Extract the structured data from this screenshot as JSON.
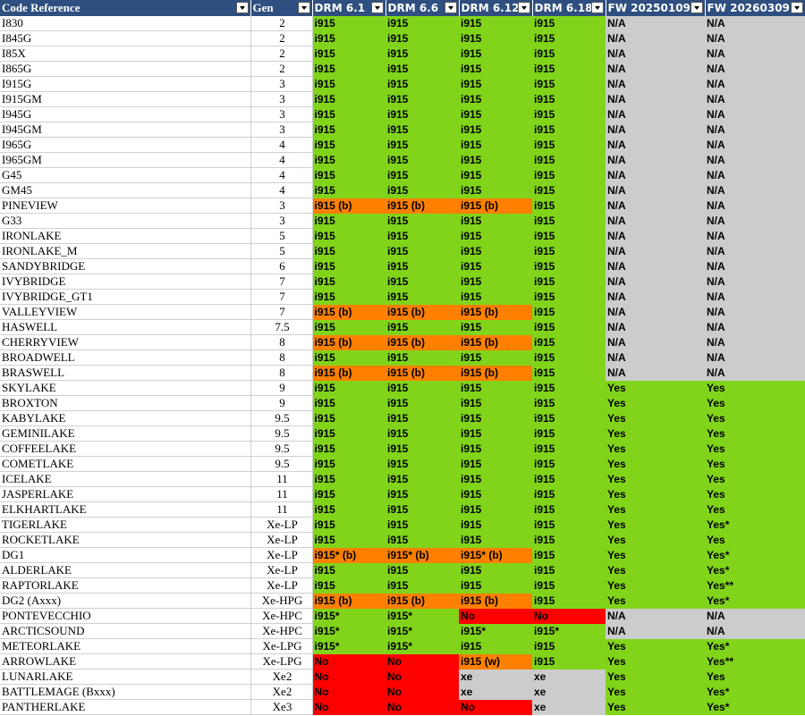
{
  "header": {
    "columns": [
      "Code Reference",
      "Gen",
      "DRM 6.1",
      "DRM 6.6",
      "DRM 6.12",
      "DRM 6.18",
      "FW 20250109",
      "FW 20260309"
    ]
  },
  "status_colors": {
    "supported": "#81d41a",
    "partial": "#ff8000",
    "unsupported": "#ff0000",
    "not_applicable": "#cccccc",
    "header_bg": "#2e4f7f"
  },
  "rows": [
    {
      "name": "I830",
      "gen": "2",
      "cells": [
        [
          "i915",
          "g"
        ],
        [
          "i915",
          "g"
        ],
        [
          "i915",
          "g"
        ],
        [
          "i915",
          "g"
        ],
        [
          "N/A",
          "x"
        ],
        [
          "N/A",
          "x"
        ]
      ]
    },
    {
      "name": "I845G",
      "gen": "2",
      "cells": [
        [
          "i915",
          "g"
        ],
        [
          "i915",
          "g"
        ],
        [
          "i915",
          "g"
        ],
        [
          "i915",
          "g"
        ],
        [
          "N/A",
          "x"
        ],
        [
          "N/A",
          "x"
        ]
      ]
    },
    {
      "name": "I85X",
      "gen": "2",
      "cells": [
        [
          "i915",
          "g"
        ],
        [
          "i915",
          "g"
        ],
        [
          "i915",
          "g"
        ],
        [
          "i915",
          "g"
        ],
        [
          "N/A",
          "x"
        ],
        [
          "N/A",
          "x"
        ]
      ]
    },
    {
      "name": "I865G",
      "gen": "2",
      "cells": [
        [
          "i915",
          "g"
        ],
        [
          "i915",
          "g"
        ],
        [
          "i915",
          "g"
        ],
        [
          "i915",
          "g"
        ],
        [
          "N/A",
          "x"
        ],
        [
          "N/A",
          "x"
        ]
      ]
    },
    {
      "name": "I915G",
      "gen": "3",
      "cells": [
        [
          "i915",
          "g"
        ],
        [
          "i915",
          "g"
        ],
        [
          "i915",
          "g"
        ],
        [
          "i915",
          "g"
        ],
        [
          "N/A",
          "x"
        ],
        [
          "N/A",
          "x"
        ]
      ]
    },
    {
      "name": "I915GM",
      "gen": "3",
      "cells": [
        [
          "i915",
          "g"
        ],
        [
          "i915",
          "g"
        ],
        [
          "i915",
          "g"
        ],
        [
          "i915",
          "g"
        ],
        [
          "N/A",
          "x"
        ],
        [
          "N/A",
          "x"
        ]
      ]
    },
    {
      "name": "I945G",
      "gen": "3",
      "cells": [
        [
          "i915",
          "g"
        ],
        [
          "i915",
          "g"
        ],
        [
          "i915",
          "g"
        ],
        [
          "i915",
          "g"
        ],
        [
          "N/A",
          "x"
        ],
        [
          "N/A",
          "x"
        ]
      ]
    },
    {
      "name": "I945GM",
      "gen": "3",
      "cells": [
        [
          "i915",
          "g"
        ],
        [
          "i915",
          "g"
        ],
        [
          "i915",
          "g"
        ],
        [
          "i915",
          "g"
        ],
        [
          "N/A",
          "x"
        ],
        [
          "N/A",
          "x"
        ]
      ]
    },
    {
      "name": "I965G",
      "gen": "4",
      "cells": [
        [
          "i915",
          "g"
        ],
        [
          "i915",
          "g"
        ],
        [
          "i915",
          "g"
        ],
        [
          "i915",
          "g"
        ],
        [
          "N/A",
          "x"
        ],
        [
          "N/A",
          "x"
        ]
      ]
    },
    {
      "name": "I965GM",
      "gen": "4",
      "cells": [
        [
          "i915",
          "g"
        ],
        [
          "i915",
          "g"
        ],
        [
          "i915",
          "g"
        ],
        [
          "i915",
          "g"
        ],
        [
          "N/A",
          "x"
        ],
        [
          "N/A",
          "x"
        ]
      ]
    },
    {
      "name": "G45",
      "gen": "4",
      "cells": [
        [
          "i915",
          "g"
        ],
        [
          "i915",
          "g"
        ],
        [
          "i915",
          "g"
        ],
        [
          "i915",
          "g"
        ],
        [
          "N/A",
          "x"
        ],
        [
          "N/A",
          "x"
        ]
      ]
    },
    {
      "name": "GM45",
      "gen": "4",
      "cells": [
        [
          "i915",
          "g"
        ],
        [
          "i915",
          "g"
        ],
        [
          "i915",
          "g"
        ],
        [
          "i915",
          "g"
        ],
        [
          "N/A",
          "x"
        ],
        [
          "N/A",
          "x"
        ]
      ]
    },
    {
      "name": "PINEVIEW",
      "gen": "3",
      "cells": [
        [
          "i915 (b)",
          "o"
        ],
        [
          "i915 (b)",
          "o"
        ],
        [
          "i915 (b)",
          "o"
        ],
        [
          "i915",
          "g"
        ],
        [
          "N/A",
          "x"
        ],
        [
          "N/A",
          "x"
        ]
      ]
    },
    {
      "name": "G33",
      "gen": "3",
      "cells": [
        [
          "i915",
          "g"
        ],
        [
          "i915",
          "g"
        ],
        [
          "i915",
          "g"
        ],
        [
          "i915",
          "g"
        ],
        [
          "N/A",
          "x"
        ],
        [
          "N/A",
          "x"
        ]
      ]
    },
    {
      "name": "IRONLAKE",
      "gen": "5",
      "cells": [
        [
          "i915",
          "g"
        ],
        [
          "i915",
          "g"
        ],
        [
          "i915",
          "g"
        ],
        [
          "i915",
          "g"
        ],
        [
          "N/A",
          "x"
        ],
        [
          "N/A",
          "x"
        ]
      ]
    },
    {
      "name": "IRONLAKE_M",
      "gen": "5",
      "cells": [
        [
          "i915",
          "g"
        ],
        [
          "i915",
          "g"
        ],
        [
          "i915",
          "g"
        ],
        [
          "i915",
          "g"
        ],
        [
          "N/A",
          "x"
        ],
        [
          "N/A",
          "x"
        ]
      ]
    },
    {
      "name": "SANDYBRIDGE",
      "gen": "6",
      "cells": [
        [
          "i915",
          "g"
        ],
        [
          "i915",
          "g"
        ],
        [
          "i915",
          "g"
        ],
        [
          "i915",
          "g"
        ],
        [
          "N/A",
          "x"
        ],
        [
          "N/A",
          "x"
        ]
      ]
    },
    {
      "name": "IVYBRIDGE",
      "gen": "7",
      "cells": [
        [
          "i915",
          "g"
        ],
        [
          "i915",
          "g"
        ],
        [
          "i915",
          "g"
        ],
        [
          "i915",
          "g"
        ],
        [
          "N/A",
          "x"
        ],
        [
          "N/A",
          "x"
        ]
      ]
    },
    {
      "name": "IVYBRIDGE_GT1",
      "gen": "7",
      "cells": [
        [
          "i915",
          "g"
        ],
        [
          "i915",
          "g"
        ],
        [
          "i915",
          "g"
        ],
        [
          "i915",
          "g"
        ],
        [
          "N/A",
          "x"
        ],
        [
          "N/A",
          "x"
        ]
      ]
    },
    {
      "name": "VALLEYVIEW",
      "gen": "7",
      "cells": [
        [
          "i915 (b)",
          "o"
        ],
        [
          "i915 (b)",
          "o"
        ],
        [
          "i915 (b)",
          "o"
        ],
        [
          "i915",
          "g"
        ],
        [
          "N/A",
          "x"
        ],
        [
          "N/A",
          "x"
        ]
      ]
    },
    {
      "name": "HASWELL",
      "gen": "7.5",
      "cells": [
        [
          "i915",
          "g"
        ],
        [
          "i915",
          "g"
        ],
        [
          "i915",
          "g"
        ],
        [
          "i915",
          "g"
        ],
        [
          "N/A",
          "x"
        ],
        [
          "N/A",
          "x"
        ]
      ]
    },
    {
      "name": "CHERRYVIEW",
      "gen": "8",
      "cells": [
        [
          "i915 (b)",
          "o"
        ],
        [
          "i915 (b)",
          "o"
        ],
        [
          "i915 (b)",
          "o"
        ],
        [
          "i915",
          "g"
        ],
        [
          "N/A",
          "x"
        ],
        [
          "N/A",
          "x"
        ]
      ]
    },
    {
      "name": "BROADWELL",
      "gen": "8",
      "cells": [
        [
          "i915",
          "g"
        ],
        [
          "i915",
          "g"
        ],
        [
          "i915",
          "g"
        ],
        [
          "i915",
          "g"
        ],
        [
          "N/A",
          "x"
        ],
        [
          "N/A",
          "x"
        ]
      ]
    },
    {
      "name": "BRASWELL",
      "gen": "8",
      "cells": [
        [
          "i915 (b)",
          "o"
        ],
        [
          "i915 (b)",
          "o"
        ],
        [
          "i915 (b)",
          "o"
        ],
        [
          "i915",
          "g"
        ],
        [
          "N/A",
          "x"
        ],
        [
          "N/A",
          "x"
        ]
      ]
    },
    {
      "name": "SKYLAKE",
      "gen": "9",
      "cells": [
        [
          "i915",
          "g"
        ],
        [
          "i915",
          "g"
        ],
        [
          "i915",
          "g"
        ],
        [
          "i915",
          "g"
        ],
        [
          "Yes",
          "g"
        ],
        [
          "Yes",
          "g"
        ]
      ]
    },
    {
      "name": "BROXTON",
      "gen": "9",
      "cells": [
        [
          "i915",
          "g"
        ],
        [
          "i915",
          "g"
        ],
        [
          "i915",
          "g"
        ],
        [
          "i915",
          "g"
        ],
        [
          "Yes",
          "g"
        ],
        [
          "Yes",
          "g"
        ]
      ]
    },
    {
      "name": "KABYLAKE",
      "gen": "9.5",
      "cells": [
        [
          "i915",
          "g"
        ],
        [
          "i915",
          "g"
        ],
        [
          "i915",
          "g"
        ],
        [
          "i915",
          "g"
        ],
        [
          "Yes",
          "g"
        ],
        [
          "Yes",
          "g"
        ]
      ]
    },
    {
      "name": "GEMINILAKE",
      "gen": "9.5",
      "cells": [
        [
          "i915",
          "g"
        ],
        [
          "i915",
          "g"
        ],
        [
          "i915",
          "g"
        ],
        [
          "i915",
          "g"
        ],
        [
          "Yes",
          "g"
        ],
        [
          "Yes",
          "g"
        ]
      ]
    },
    {
      "name": "COFFEELAKE",
      "gen": "9.5",
      "cells": [
        [
          "i915",
          "g"
        ],
        [
          "i915",
          "g"
        ],
        [
          "i915",
          "g"
        ],
        [
          "i915",
          "g"
        ],
        [
          "Yes",
          "g"
        ],
        [
          "Yes",
          "g"
        ]
      ]
    },
    {
      "name": "COMETLAKE",
      "gen": "9.5",
      "cells": [
        [
          "i915",
          "g"
        ],
        [
          "i915",
          "g"
        ],
        [
          "i915",
          "g"
        ],
        [
          "i915",
          "g"
        ],
        [
          "Yes",
          "g"
        ],
        [
          "Yes",
          "g"
        ]
      ]
    },
    {
      "name": "ICELAKE",
      "gen": "11",
      "cells": [
        [
          "i915",
          "g"
        ],
        [
          "i915",
          "g"
        ],
        [
          "i915",
          "g"
        ],
        [
          "i915",
          "g"
        ],
        [
          "Yes",
          "g"
        ],
        [
          "Yes",
          "g"
        ]
      ]
    },
    {
      "name": "JASPERLAKE",
      "gen": "11",
      "cells": [
        [
          "i915",
          "g"
        ],
        [
          "i915",
          "g"
        ],
        [
          "i915",
          "g"
        ],
        [
          "i915",
          "g"
        ],
        [
          "Yes",
          "g"
        ],
        [
          "Yes",
          "g"
        ]
      ]
    },
    {
      "name": "ELKHARTLAKE",
      "gen": "11",
      "cells": [
        [
          "i915",
          "g"
        ],
        [
          "i915",
          "g"
        ],
        [
          "i915",
          "g"
        ],
        [
          "i915",
          "g"
        ],
        [
          "Yes",
          "g"
        ],
        [
          "Yes",
          "g"
        ]
      ]
    },
    {
      "name": "TIGERLAKE",
      "gen": "Xe-LP",
      "cells": [
        [
          "i915",
          "g"
        ],
        [
          "i915",
          "g"
        ],
        [
          "i915",
          "g"
        ],
        [
          "i915",
          "g"
        ],
        [
          "Yes",
          "g"
        ],
        [
          "Yes*",
          "g"
        ]
      ]
    },
    {
      "name": "ROCKETLAKE",
      "gen": "Xe-LP",
      "cells": [
        [
          "i915",
          "g"
        ],
        [
          "i915",
          "g"
        ],
        [
          "i915",
          "g"
        ],
        [
          "i915",
          "g"
        ],
        [
          "Yes",
          "g"
        ],
        [
          "Yes",
          "g"
        ]
      ]
    },
    {
      "name": "DG1",
      "gen": "Xe-LP",
      "cells": [
        [
          "i915* (b)",
          "o"
        ],
        [
          "i915* (b)",
          "o"
        ],
        [
          "i915* (b)",
          "o"
        ],
        [
          "i915",
          "g"
        ],
        [
          "Yes",
          "g"
        ],
        [
          "Yes*",
          "g"
        ]
      ]
    },
    {
      "name": "ALDERLAKE",
      "gen": "Xe-LP",
      "cells": [
        [
          "i915",
          "g"
        ],
        [
          "i915",
          "g"
        ],
        [
          "i915",
          "g"
        ],
        [
          "i915",
          "g"
        ],
        [
          "Yes",
          "g"
        ],
        [
          "Yes*",
          "g"
        ]
      ]
    },
    {
      "name": "RAPTORLAKE",
      "gen": "Xe-LP",
      "cells": [
        [
          "i915",
          "g"
        ],
        [
          "i915",
          "g"
        ],
        [
          "i915",
          "g"
        ],
        [
          "i915",
          "g"
        ],
        [
          "Yes",
          "g"
        ],
        [
          "Yes**",
          "g"
        ]
      ]
    },
    {
      "name": "DG2 (Axxx)",
      "gen": "Xe-HPG",
      "cells": [
        [
          "i915 (b)",
          "o"
        ],
        [
          "i915 (b)",
          "o"
        ],
        [
          "i915 (b)",
          "o"
        ],
        [
          "i915",
          "g"
        ],
        [
          "Yes",
          "g"
        ],
        [
          "Yes*",
          "g"
        ]
      ]
    },
    {
      "name": "PONTEVECCHIO",
      "gen": "Xe-HPC",
      "cells": [
        [
          "i915*",
          "g"
        ],
        [
          "i915*",
          "g"
        ],
        [
          "No",
          "r"
        ],
        [
          "No",
          "r"
        ],
        [
          "N/A",
          "x"
        ],
        [
          "N/A",
          "x"
        ]
      ]
    },
    {
      "name": "ARCTICSOUND",
      "gen": "Xe-HPC",
      "cells": [
        [
          "i915*",
          "g"
        ],
        [
          "i915*",
          "g"
        ],
        [
          "i915*",
          "g"
        ],
        [
          "i915*",
          "g"
        ],
        [
          "N/A",
          "x"
        ],
        [
          "N/A",
          "x"
        ]
      ]
    },
    {
      "name": "METEORLAKE",
      "gen": "Xe-LPG",
      "cells": [
        [
          "i915*",
          "g"
        ],
        [
          "i915*",
          "g"
        ],
        [
          "i915",
          "g"
        ],
        [
          "i915",
          "g"
        ],
        [
          "Yes",
          "g"
        ],
        [
          "Yes*",
          "g"
        ]
      ]
    },
    {
      "name": "ARROWLAKE",
      "gen": "Xe-LPG",
      "cells": [
        [
          "No",
          "r"
        ],
        [
          "No",
          "r"
        ],
        [
          "i915 (w)",
          "o"
        ],
        [
          "i915",
          "g"
        ],
        [
          "Yes",
          "g"
        ],
        [
          "Yes**",
          "g"
        ]
      ]
    },
    {
      "name": "LUNARLAKE",
      "gen": "Xe2",
      "cells": [
        [
          "No",
          "r"
        ],
        [
          "No",
          "r"
        ],
        [
          "xe",
          "x"
        ],
        [
          "xe",
          "x"
        ],
        [
          "Yes",
          "g"
        ],
        [
          "Yes",
          "g"
        ]
      ]
    },
    {
      "name": "BATTLEMAGE (Bxxx)",
      "gen": "Xe2",
      "cells": [
        [
          "No",
          "r"
        ],
        [
          "No",
          "r"
        ],
        [
          "xe",
          "x"
        ],
        [
          "xe",
          "x"
        ],
        [
          "Yes",
          "g"
        ],
        [
          "Yes*",
          "g"
        ]
      ]
    },
    {
      "name": "PANTHERLAKE",
      "gen": "Xe3",
      "cells": [
        [
          "No",
          "r"
        ],
        [
          "No",
          "r"
        ],
        [
          "No",
          "r"
        ],
        [
          "xe",
          "x"
        ],
        [
          "Yes",
          "g"
        ],
        [
          "Yes*",
          "g"
        ]
      ]
    }
  ]
}
